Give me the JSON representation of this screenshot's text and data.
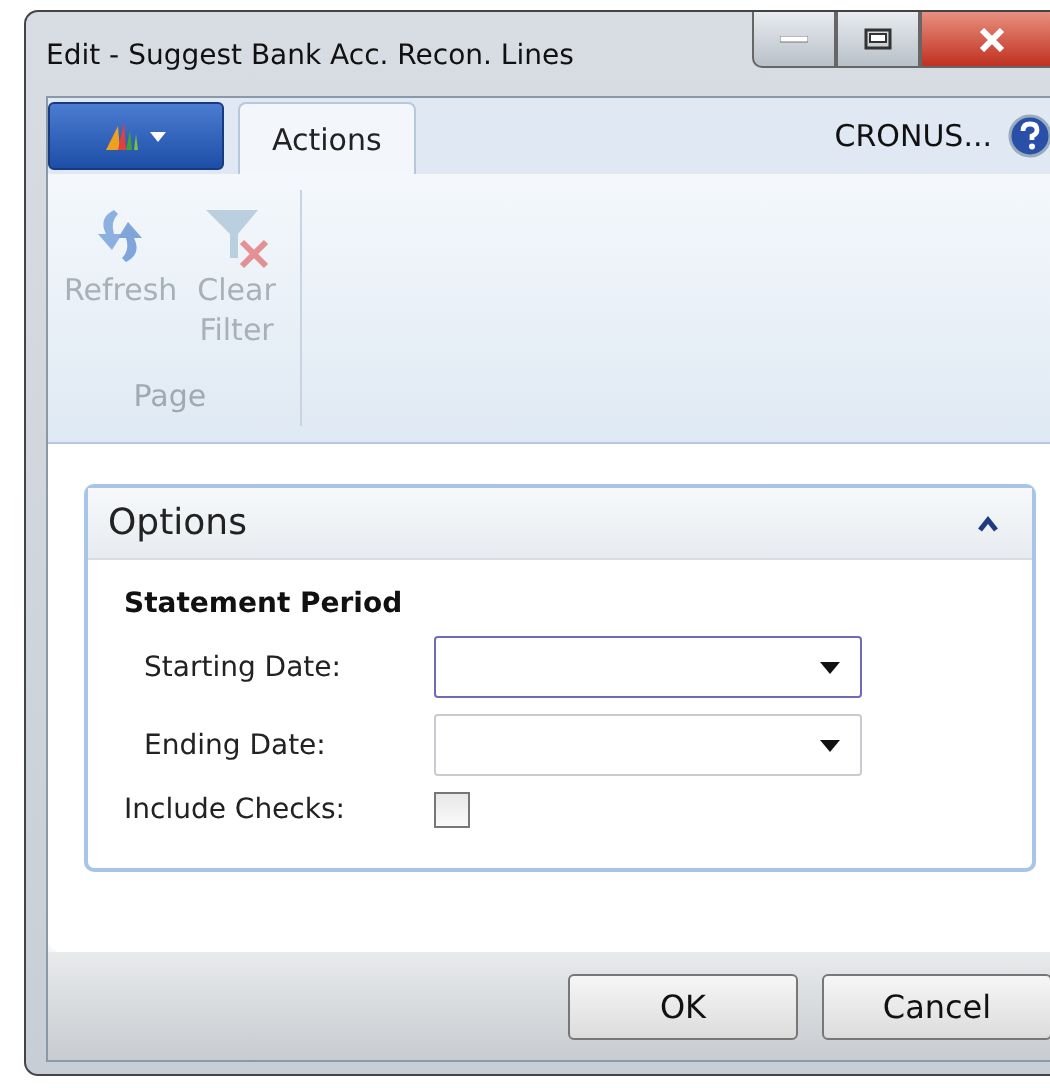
{
  "window": {
    "title": "Edit - Suggest Bank Acc. Recon. Lines"
  },
  "tabs": [
    {
      "label": "Actions",
      "selected": true
    }
  ],
  "company": "CRONUS...",
  "ribbon": {
    "groups": [
      {
        "label": "Page",
        "actions": [
          {
            "kind": "refresh",
            "label": "Refresh",
            "disabled": true
          },
          {
            "kind": "clear-filter",
            "label": "Clear Filter",
            "disabled": true
          }
        ]
      }
    ]
  },
  "options": {
    "title": "Options",
    "expanded": true,
    "section": "Statement Period",
    "fields": [
      {
        "kind": "date",
        "label": "Starting Date:",
        "focused": true
      },
      {
        "kind": "date",
        "label": "Ending Date:",
        "focused": false
      },
      {
        "kind": "checkbox",
        "label": "Include Checks:",
        "checked": false
      }
    ]
  },
  "buttons": [
    "OK",
    "Cancel"
  ]
}
